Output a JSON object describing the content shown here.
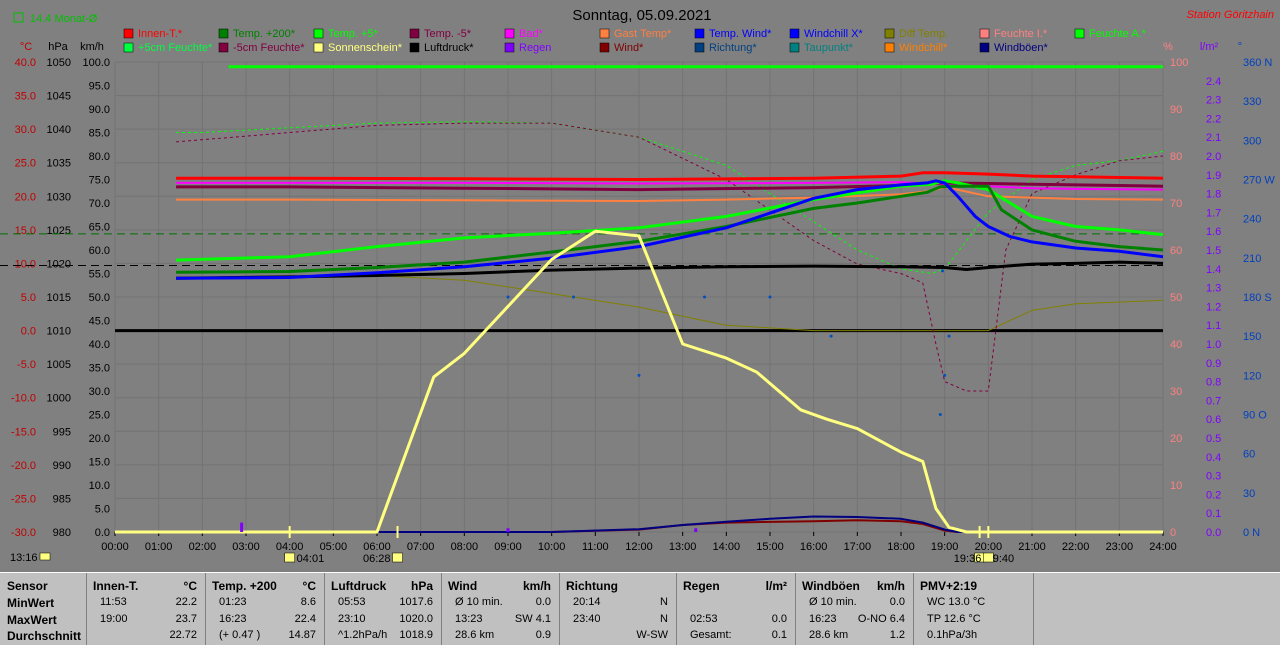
{
  "header": {
    "title": "Sonntag, 05.09.2021",
    "station": "Station Göritzhain",
    "avg_label": "14.4 Monat-Ø"
  },
  "chart_data": {
    "type": "line",
    "title": "Sonntag, 05.09.2021",
    "x_range": [
      0,
      24
    ],
    "x_ticks": [
      "00:00",
      "01:00",
      "02:00",
      "03:00",
      "04:00",
      "05:00",
      "06:00",
      "07:00",
      "08:00",
      "09:00",
      "10:00",
      "11:00",
      "12:00",
      "13:00",
      "14:00",
      "15:00",
      "16:00",
      "17:00",
      "18:00",
      "19:00",
      "20:00",
      "21:00",
      "22:00",
      "23:00",
      "24:00"
    ],
    "axes": {
      "temp": {
        "label": "°C",
        "color": "#c00000",
        "range": [
          -30,
          40
        ],
        "ticks": [
          "40.0",
          "35.0",
          "30.0",
          "25.0",
          "20.0",
          "15.0",
          "10.0",
          "5.0",
          "0.0",
          "-5.0",
          "-10.0",
          "-15.0",
          "-20.0",
          "-25.0",
          "-30.0"
        ]
      },
      "pressure": {
        "label": "hPa",
        "color": "#000000",
        "range": [
          980,
          1050
        ],
        "ticks": [
          "1050",
          "1045",
          "1040",
          "1035",
          "1030",
          "1025",
          "1020",
          "1015",
          "1010",
          "1005",
          "1000",
          "995",
          "990",
          "985",
          "980"
        ]
      },
      "wind": {
        "label": "km/h",
        "color": "#000000",
        "range": [
          0,
          100
        ],
        "ticks": [
          "100.0",
          "95.0",
          "90.0",
          "85.0",
          "80.0",
          "75.0",
          "70.0",
          "65.0",
          "60.0",
          "55.0",
          "50.0",
          "45.0",
          "40.0",
          "35.0",
          "30.0",
          "25.0",
          "20.0",
          "15.0",
          "10.0",
          "5.0",
          "0.0"
        ]
      },
      "humidity": {
        "label": "%",
        "color": "#ff8080",
        "range": [
          0,
          100
        ],
        "ticks": [
          "100",
          "90",
          "80",
          "70",
          "60",
          "50",
          "40",
          "30",
          "20",
          "10",
          "0"
        ]
      },
      "rain": {
        "label": "l/m²",
        "color": "#8000ff",
        "range": [
          0,
          2.5
        ],
        "ticks": [
          "2.4",
          "2.3",
          "2.2",
          "2.1",
          "2.0",
          "1.9",
          "1.8",
          "1.7",
          "1.6",
          "1.5",
          "1.4",
          "1.3",
          "1.2",
          "1.1",
          "1.0",
          "0.9",
          "0.8",
          "0.7",
          "0.6",
          "0.5",
          "0.4",
          "0.3",
          "0.2",
          "0.1",
          "0.0"
        ]
      },
      "direction": {
        "label": "°",
        "color": "#0040c0",
        "range": [
          0,
          360
        ],
        "ticks": [
          "360 N",
          "330",
          "300",
          "270 W",
          "240",
          "210",
          "180 S",
          "150",
          "120",
          "90 O",
          "60",
          "30",
          "0 N"
        ]
      }
    },
    "legend": [
      {
        "name": "Innen-T.*",
        "color": "#ff0000"
      },
      {
        "name": "Temp. +200*",
        "color": "#008000"
      },
      {
        "name": "Temp. +5*",
        "color": "#00ff00"
      },
      {
        "name": "Temp. -5*",
        "color": "#800040"
      },
      {
        "name": "Bad*",
        "color": "#ff00ff"
      },
      {
        "name": "Gast Temp*",
        "color": "#ff8040"
      },
      {
        "name": "Temp. Wind*",
        "color": "#0000ff"
      },
      {
        "name": "Windchill X*",
        "color": "#0000ff"
      },
      {
        "name": "Diff Temp.",
        "color": "#808000"
      },
      {
        "name": "Feuchte I.*",
        "color": "#ff8080"
      },
      {
        "name": "Feuchte A.*",
        "color": "#00ff00"
      },
      {
        "name": "+5cm Feuchte*",
        "color": "#00ff40"
      },
      {
        "name": "-5cm Feuchte*",
        "color": "#800040"
      },
      {
        "name": "Sonnenschein*",
        "color": "#ffff80"
      },
      {
        "name": "Luftdruck*",
        "color": "#000000"
      },
      {
        "name": "Regen",
        "color": "#8000ff"
      },
      {
        "name": "Wind*",
        "color": "#800000"
      },
      {
        "name": "Richtung*",
        "color": "#004080"
      },
      {
        "name": "Taupunkt*",
        "color": "#008080"
      },
      {
        "name": "Windchill*",
        "color": "#ff8000"
      },
      {
        "name": "Windböen*",
        "color": "#000080"
      }
    ],
    "series": [
      {
        "name": "Innen-T.*",
        "axis": "temp",
        "color": "#ff0000",
        "width": 3,
        "x": [
          1.4,
          4,
          8,
          12,
          16,
          18,
          18.5,
          19,
          20,
          21,
          22,
          23,
          24
        ],
        "y": [
          22.7,
          22.7,
          22.6,
          22.5,
          22.7,
          23.0,
          23.5,
          23.5,
          23.3,
          23.0,
          22.9,
          22.8,
          22.7
        ]
      },
      {
        "name": "Temp. +200*",
        "axis": "temp",
        "color": "#008000",
        "width": 3,
        "x": [
          1.4,
          4,
          6,
          8,
          10,
          12,
          14,
          16,
          17,
          18,
          18.6,
          18.9,
          19.2,
          20,
          20.3,
          21,
          22,
          23,
          24
        ],
        "y": [
          8.7,
          8.8,
          9.4,
          10.2,
          11.7,
          13.3,
          15.5,
          18.2,
          19.0,
          20.0,
          20.6,
          21.4,
          21.5,
          21.5,
          18.0,
          15.0,
          13.3,
          12.5,
          12.0
        ]
      },
      {
        "name": "Temp. +5*",
        "axis": "temp",
        "color": "#00ff00",
        "width": 3,
        "x": [
          1.4,
          4,
          6,
          8,
          10,
          12,
          14,
          16,
          18,
          18.7,
          19,
          19.3,
          20,
          21,
          22,
          23,
          24
        ],
        "y": [
          10.5,
          11.0,
          12.5,
          13.8,
          14.5,
          15.3,
          17.0,
          19.5,
          21.5,
          21.8,
          22.3,
          22.0,
          21.0,
          17.0,
          15.5,
          15.0,
          14.3
        ]
      },
      {
        "name": "Temp. -5*",
        "axis": "temp",
        "color": "#800040",
        "width": 3,
        "x": [
          1.4,
          4,
          8,
          12,
          16,
          18,
          19,
          20,
          21,
          22,
          23,
          24
        ],
        "y": [
          21.4,
          21.4,
          21.2,
          21.0,
          21.3,
          21.6,
          22.0,
          21.9,
          21.8,
          21.7,
          21.6,
          21.5
        ]
      },
      {
        "name": "Bad*",
        "axis": "temp",
        "color": "#ff00ff",
        "width": 2,
        "x": [
          1.4,
          4,
          8,
          12,
          16,
          18,
          19,
          20,
          21,
          22,
          24
        ],
        "y": [
          22.0,
          22.0,
          22.0,
          21.9,
          22.0,
          22.1,
          21.8,
          21.5,
          21.2,
          21.1,
          21.0
        ]
      },
      {
        "name": "Gast Temp*",
        "axis": "temp",
        "color": "#ff8040",
        "width": 2,
        "x": [
          1.4,
          4,
          8,
          12,
          14,
          16,
          18,
          18.7,
          19,
          20,
          21,
          22,
          24
        ],
        "y": [
          19.5,
          19.5,
          19.4,
          19.3,
          19.5,
          19.8,
          20.3,
          20.8,
          21.4,
          20.0,
          19.8,
          19.6,
          19.5
        ]
      },
      {
        "name": "Temp. Wind*",
        "axis": "temp",
        "color": "#0000ff",
        "width": 3,
        "x": [
          1.4,
          4,
          6,
          8,
          10,
          12,
          14,
          15,
          16,
          17,
          18,
          18.6,
          18.8,
          19,
          19.3,
          19.7,
          20,
          20.5,
          21,
          22,
          23,
          24
        ],
        "y": [
          7.8,
          7.9,
          8.6,
          9.5,
          10.8,
          12.5,
          15.3,
          17.5,
          19.7,
          21.0,
          21.7,
          22.0,
          22.3,
          22.0,
          20.0,
          17.0,
          15.5,
          14.0,
          13.2,
          12.3,
          11.8,
          11.0
        ]
      },
      {
        "name": "+5cm Feuchte*",
        "axis": "humidity",
        "color": "#00ff00",
        "width": 1,
        "dash": "3,3",
        "x": [
          1.4,
          2,
          4,
          6,
          8,
          10,
          12,
          14,
          16,
          17,
          18,
          18.7,
          19,
          19.5,
          20,
          21,
          22,
          23,
          24
        ],
        "y": [
          85,
          85,
          86,
          87,
          87.3,
          87,
          84,
          78,
          66,
          60,
          56,
          55,
          56,
          62,
          68,
          75,
          78,
          79,
          81
        ]
      },
      {
        "name": "-5cm Feuchte*",
        "axis": "humidity",
        "color": "#800040",
        "width": 1,
        "dash": "3,3",
        "x": [
          1.4,
          4,
          6,
          8,
          10,
          12,
          14,
          16,
          17,
          18,
          18.5,
          18.8,
          19,
          19.5,
          20,
          20.4,
          21,
          22,
          23,
          24
        ],
        "y": [
          83,
          85,
          86.5,
          87,
          87,
          84,
          75,
          62,
          57,
          55,
          53,
          40,
          32,
          30,
          30,
          60,
          72,
          76,
          79,
          80
        ]
      },
      {
        "name": "Sonnenschein*",
        "axis": "wind",
        "color": "#ffff80",
        "width": 3,
        "x": [
          0,
          6.0,
          7.3,
          8.0,
          9.0,
          10.0,
          11.0,
          12.0,
          13.0,
          14.0,
          14.7,
          15.7,
          16.3,
          17.0,
          18.0,
          18.5,
          18.8,
          19.1,
          19.5,
          24
        ],
        "y": [
          0,
          0,
          33,
          38,
          48,
          58,
          64,
          63,
          40,
          37,
          34,
          26,
          24,
          22,
          17,
          15,
          5,
          1,
          0,
          0
        ]
      },
      {
        "name": "Luftdruck*",
        "axis": "pressure",
        "color": "#000000",
        "width": 3,
        "x": [
          1.4,
          4,
          6,
          8,
          10,
          12,
          14,
          16,
          18,
          19,
          19.5,
          20,
          21,
          22,
          23,
          24
        ],
        "y": [
          1017.8,
          1018.0,
          1018.2,
          1018.5,
          1019.0,
          1019.3,
          1019.5,
          1019.6,
          1019.5,
          1019.4,
          1019.1,
          1019.4,
          1019.9,
          1020.0,
          1020.2,
          1020.0
        ]
      },
      {
        "name": "Diff Temp.",
        "axis": "temp",
        "color": "#808000",
        "width": 1,
        "x": [
          1.4,
          4,
          6,
          8,
          10,
          12,
          14,
          16,
          18,
          18.8,
          19,
          20,
          21,
          22,
          24
        ],
        "y": [
          8.0,
          8.0,
          8.2,
          7.5,
          5.5,
          3.5,
          0.8,
          0,
          0,
          0,
          0,
          0,
          3.0,
          4.0,
          4.5
        ]
      },
      {
        "name": "Wind*",
        "axis": "wind",
        "color": "#800000",
        "width": 2,
        "x": [
          1.4,
          6,
          10,
          12,
          13,
          14,
          16,
          17,
          18,
          18.5,
          19,
          19.3,
          24
        ],
        "y": [
          0,
          0,
          0,
          0.5,
          1.5,
          2.0,
          2.3,
          2.5,
          2.3,
          1.7,
          0.3,
          0,
          0
        ]
      },
      {
        "name": "Windböen*",
        "axis": "wind",
        "color": "#000080",
        "width": 2,
        "x": [
          1.4,
          6,
          10,
          12,
          13,
          14,
          15,
          16,
          17,
          18,
          18.5,
          19,
          19.3,
          24
        ],
        "y": [
          0,
          0,
          0,
          0.6,
          1.5,
          2.2,
          2.8,
          3.3,
          3.2,
          2.8,
          2.0,
          0.5,
          0,
          0
        ]
      }
    ],
    "constant_lines": [
      {
        "name": "Feuchte A.*",
        "axis": "wind",
        "color": "#00ff00",
        "y": 99.0
      },
      {
        "name": "zero",
        "axis": "temp",
        "color": "#000000",
        "y": 0
      },
      {
        "name": "dashed-green",
        "axis": "temp",
        "color": "#007000",
        "y": 14.4
      },
      {
        "name": "dashed-black",
        "axis": "pressure",
        "color": "#000000",
        "y": 1019.7
      }
    ],
    "direction_points": {
      "axis": "direction",
      "color": "#0050c0",
      "x": [
        9.0,
        10.5,
        12.0,
        13.5,
        15.0,
        16.4,
        18.9,
        19.0,
        19.1,
        18.95
      ],
      "y": [
        180,
        180,
        120,
        180,
        180,
        150,
        90,
        120,
        150,
        200
      ]
    },
    "rain_bars": {
      "axis": "rain",
      "color": "#8000ff",
      "x": [
        2.9,
        9.0,
        13.3
      ],
      "y": [
        0.05,
        0.02,
        0.02
      ]
    },
    "sun_markers": [
      {
        "x": 4.0,
        "label": "04:01"
      },
      {
        "x": 6.47,
        "label": "06:28"
      },
      {
        "x": 19.8,
        "label": "19:40"
      },
      {
        "x": 20.0,
        "label": "19:36"
      }
    ],
    "corner_time": "13:16"
  },
  "stats": {
    "rows": [
      "Sensor",
      "MinWert",
      "MaxWert",
      "Durchschnitt"
    ],
    "columns": [
      {
        "title": "Innen-T.",
        "unit": "°C",
        "min": [
          "11:53",
          "22.2"
        ],
        "max": [
          "19:00",
          "23.7"
        ],
        "avg": [
          "",
          "22.72"
        ]
      },
      {
        "title": "Temp. +200",
        "unit": "°C",
        "min": [
          "01:23",
          "8.6"
        ],
        "max": [
          "16:23",
          "22.4"
        ],
        "avg": [
          "(+ 0.47 )",
          "14.87"
        ]
      },
      {
        "title": "Luftdruck",
        "unit": "hPa",
        "min": [
          "05:53",
          "1017.6"
        ],
        "max": [
          "23:10",
          "1020.0"
        ],
        "avg": [
          "^1.2hPa/h",
          "1018.9"
        ]
      },
      {
        "title": "Wind",
        "unit": "km/h",
        "min": [
          "Ø 10 min.",
          "0.0"
        ],
        "max": [
          "13:23",
          "SW 4.1"
        ],
        "avg": [
          "28.6 km",
          "0.9"
        ]
      },
      {
        "title": "Richtung",
        "unit": "",
        "min": [
          "20:14",
          "N"
        ],
        "max": [
          "23:40",
          "N"
        ],
        "avg": [
          "",
          "W-SW"
        ]
      },
      {
        "title": "Regen",
        "unit": "l/m²",
        "min": [
          "",
          ""
        ],
        "max": [
          "02:53",
          "0.0"
        ],
        "avg": [
          "Gesamt:",
          "0.1"
        ]
      },
      {
        "title": "Windböen",
        "unit": "km/h",
        "min": [
          "Ø 10 min.",
          "0.0"
        ],
        "max": [
          "16:23",
          "O-NO 6.4"
        ],
        "avg": [
          "28.6 km",
          "1.2"
        ]
      },
      {
        "title": "PMV+2:19",
        "unit": "",
        "min": [
          "WC 13.0 °C",
          ""
        ],
        "max": [
          "TP 12.6 °C",
          ""
        ],
        "avg": [
          "0.1hPa/3h",
          ""
        ]
      }
    ]
  }
}
